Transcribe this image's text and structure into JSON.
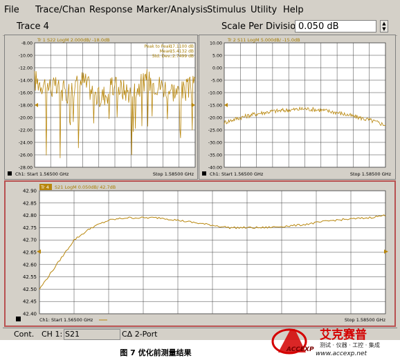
{
  "menu": [
    "File",
    "Trace/Chan",
    "Response",
    "Marker/Analysis",
    "Stimulus",
    "Utility",
    "Help"
  ],
  "entry": {
    "trace_name": "Trace 4",
    "scale_label": "Scale Per Division",
    "scale_value": "0.050 dB"
  },
  "panels": {
    "tr1": {
      "header": "Tr 1  S22 LogM 2.000dB/ -18.0dB",
      "stats": [
        {
          "label": "Peak to Peak:",
          "value": "17.1100 dB"
        },
        {
          "label": "Mean:",
          "value": "-15.4132 dB"
        },
        {
          "label": "Std. Dev.:",
          "value": "2.7499 dB"
        }
      ],
      "start": "Ch1: Start  1.56500 GHz",
      "stop": "Stop  1.58500 GHz"
    },
    "tr2": {
      "header": "Tr 2  S11 LogM 5.000dB/ -15.0dB",
      "start": "Ch1: Start  1.56500 GHz",
      "stop": "Stop  1.58500 GHz"
    },
    "tr4": {
      "header": "Tr 4",
      "header_rest": "S21 LogM 0.050dB/ 42.7dB",
      "start": "Ch1: Start  1.56500 GHz",
      "stop": "Stop  1.58500 GHz"
    }
  },
  "status": {
    "mode": "Cont.",
    "channel": "CH 1:",
    "measurement": "S21",
    "calibration": "CΔ 2-Port"
  },
  "caption": "图 7   优化前测量结果",
  "watermark": {
    "brand": "艾克赛普",
    "tagline": "测试 · 仪器 · 工控 · 集成",
    "url": "www.accexp.net",
    "logo_text": "ACCEXP"
  },
  "colors": {
    "trace": "#b8860b",
    "grid": "#3c3c3c",
    "plot_bg": "#ffffff",
    "app_bg": "#d4d0c8",
    "active_border": "#b85050"
  },
  "chart_data": [
    {
      "type": "line",
      "title": "Tr 1  S22 LogM 2.000dB/ -18.0dB",
      "yticks": [
        "-8.00",
        "-10.00",
        "-12.00",
        "-14.00",
        "-16.00",
        "-18.00",
        "-20.00",
        "-22.00",
        "-24.00",
        "-26.00",
        "-28.00"
      ],
      "ylim": [
        -28,
        -8
      ],
      "xlim": [
        1.565,
        1.585
      ],
      "xunit": "GHz",
      "series": [
        {
          "name": "S22",
          "x": [
            1.565,
            1.567,
            1.569,
            1.571,
            1.573,
            1.575,
            1.577,
            1.579,
            1.581,
            1.583,
            1.585
          ],
          "y": [
            -14,
            -15,
            -16,
            -14,
            -17,
            -15,
            -16,
            -14,
            -15,
            -16,
            -15
          ]
        }
      ]
    },
    {
      "type": "line",
      "title": "Tr 2  S11 LogM 5.000dB/ -15.0dB",
      "yticks": [
        "10.00",
        "5.00",
        "0.00",
        "-5.00",
        "-10.00",
        "-15.00",
        "-20.00",
        "-25.00",
        "-30.00",
        "-35.00",
        "-40.00"
      ],
      "ylim": [
        -40,
        10
      ],
      "xlim": [
        1.565,
        1.585
      ],
      "xunit": "GHz",
      "series": [
        {
          "name": "S11",
          "x": [
            1.565,
            1.567,
            1.569,
            1.571,
            1.573,
            1.575,
            1.577,
            1.579,
            1.581,
            1.583,
            1.585
          ],
          "y": [
            -22,
            -20,
            -18.5,
            -17.5,
            -17,
            -16.5,
            -17,
            -18,
            -19.5,
            -21,
            -23
          ]
        }
      ]
    },
    {
      "type": "line",
      "title": "Tr 4  S21 LogM 0.050dB/ 42.7dB",
      "yticks": [
        "42.90",
        "42.85",
        "42.80",
        "42.75",
        "42.70",
        "42.65",
        "42.60",
        "42.55",
        "42.50",
        "42.45",
        "42.40"
      ],
      "ylim": [
        42.4,
        42.9
      ],
      "xlim": [
        1.565,
        1.585
      ],
      "xunit": "GHz",
      "series": [
        {
          "name": "S21",
          "x": [
            1.565,
            1.566,
            1.567,
            1.568,
            1.569,
            1.57,
            1.572,
            1.574,
            1.576,
            1.578,
            1.58,
            1.582,
            1.584,
            1.585
          ],
          "y": [
            42.5,
            42.6,
            42.7,
            42.75,
            42.78,
            42.79,
            42.79,
            42.77,
            42.75,
            42.75,
            42.76,
            42.78,
            42.79,
            42.8
          ]
        }
      ]
    }
  ]
}
